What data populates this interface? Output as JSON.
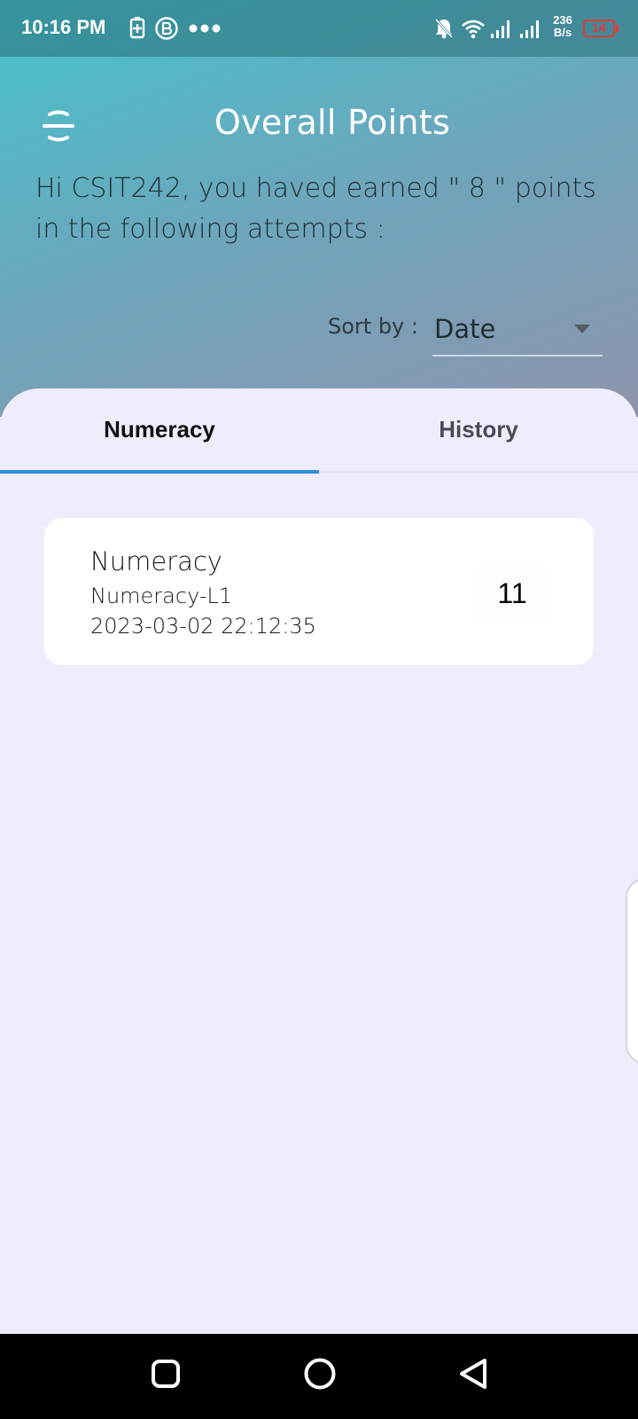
{
  "status_bar": {
    "time": "10:16 PM",
    "net_speed_value": "236",
    "net_speed_unit": "B/s",
    "battery_level": "14",
    "icons": [
      "battery-saver-icon",
      "b-app-icon",
      "more-dots-icon",
      "bell-muted-icon",
      "wifi-icon",
      "signal-icon",
      "signal-icon",
      "battery-icon"
    ],
    "battery_color": "#e53935"
  },
  "header": {
    "title": "Overall Points",
    "greeting": "Hi CSIT242, you haved earned \" 8 \" points in the following attempts :",
    "sort_label": "Sort by :",
    "sort_value": "Date"
  },
  "tabs": [
    {
      "label": "Numeracy",
      "selected": true
    },
    {
      "label": "History",
      "selected": false
    }
  ],
  "attempts": [
    {
      "title": "Numeracy",
      "subtitle": "Numeracy-L1",
      "datetime": "2023-03-02 22:12:35",
      "points": "11"
    }
  ],
  "colors": {
    "accent": "#2e8fdd",
    "gradient_start": "#45c2ca",
    "gradient_end": "#8e93ad",
    "sheet_background": "#efecfb"
  },
  "nav_bar": {
    "buttons": [
      "recents-square-icon",
      "home-circle-icon",
      "back-triangle-icon"
    ]
  }
}
